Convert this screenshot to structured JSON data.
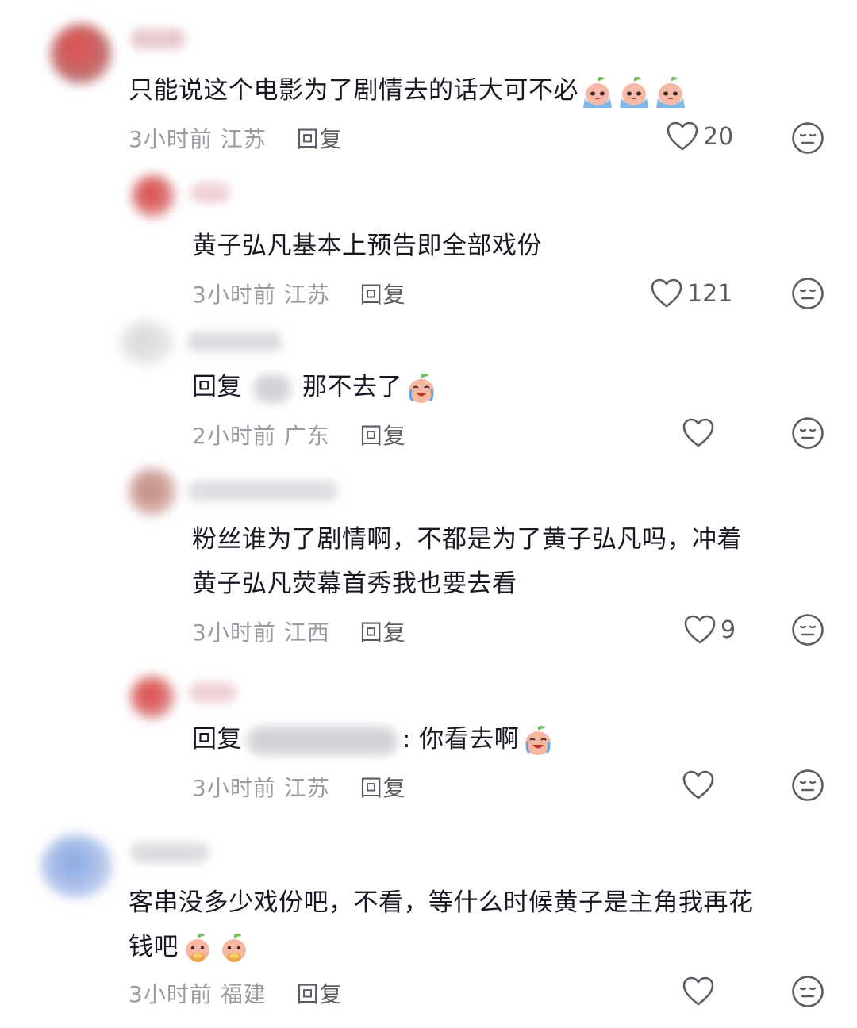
{
  "comments": [
    {
      "text": "只能说这个电影为了剧情去的话大可不必",
      "emojis": [
        "crying-peach-emoji",
        "crying-peach-emoji",
        "crying-peach-emoji"
      ],
      "time": "3小时前",
      "location": "江苏",
      "reply_label": "回复",
      "likes": "20"
    },
    {
      "text": "黄子弘凡基本上预告即全部戏份",
      "time": "3小时前",
      "location": "江苏",
      "reply_label": "回复",
      "likes": "121"
    },
    {
      "reply_prefix": "回复",
      "text": "那不去了",
      "emojis": [
        "laugh-cry-peach-emoji"
      ],
      "time": "2小时前",
      "location": "广东",
      "reply_label": "回复",
      "likes": ""
    },
    {
      "text_line1": "粉丝谁为了剧情啊，不都是为了黄子弘凡吗，冲着",
      "text_line2": "黄子弘凡荧幕首秀我也要去看",
      "time": "3小时前",
      "location": "江西",
      "reply_label": "回复",
      "likes": "9"
    },
    {
      "reply_prefix": "回复",
      "text": ": 你看去啊",
      "emojis": [
        "laugh-cry-peach-emoji"
      ],
      "time": "3小时前",
      "location": "江苏",
      "reply_label": "回复",
      "likes": ""
    },
    {
      "text_line1": "客串没多少戏份吧，不看，等什么时候黄子是主角我再花",
      "text_line2": "钱吧",
      "emojis": [
        "eating-peach-emoji",
        "eating-peach-emoji"
      ],
      "time": "3小时前",
      "location": "福建",
      "reply_label": "回复",
      "likes": ""
    }
  ],
  "icons": {
    "like": "heart-outline-icon",
    "dislike": "neutral-face-icon"
  },
  "colors": {
    "text": "#161823",
    "meta": "#9a9aa3",
    "reply": "#5b5b63",
    "background": "#ffffff"
  }
}
